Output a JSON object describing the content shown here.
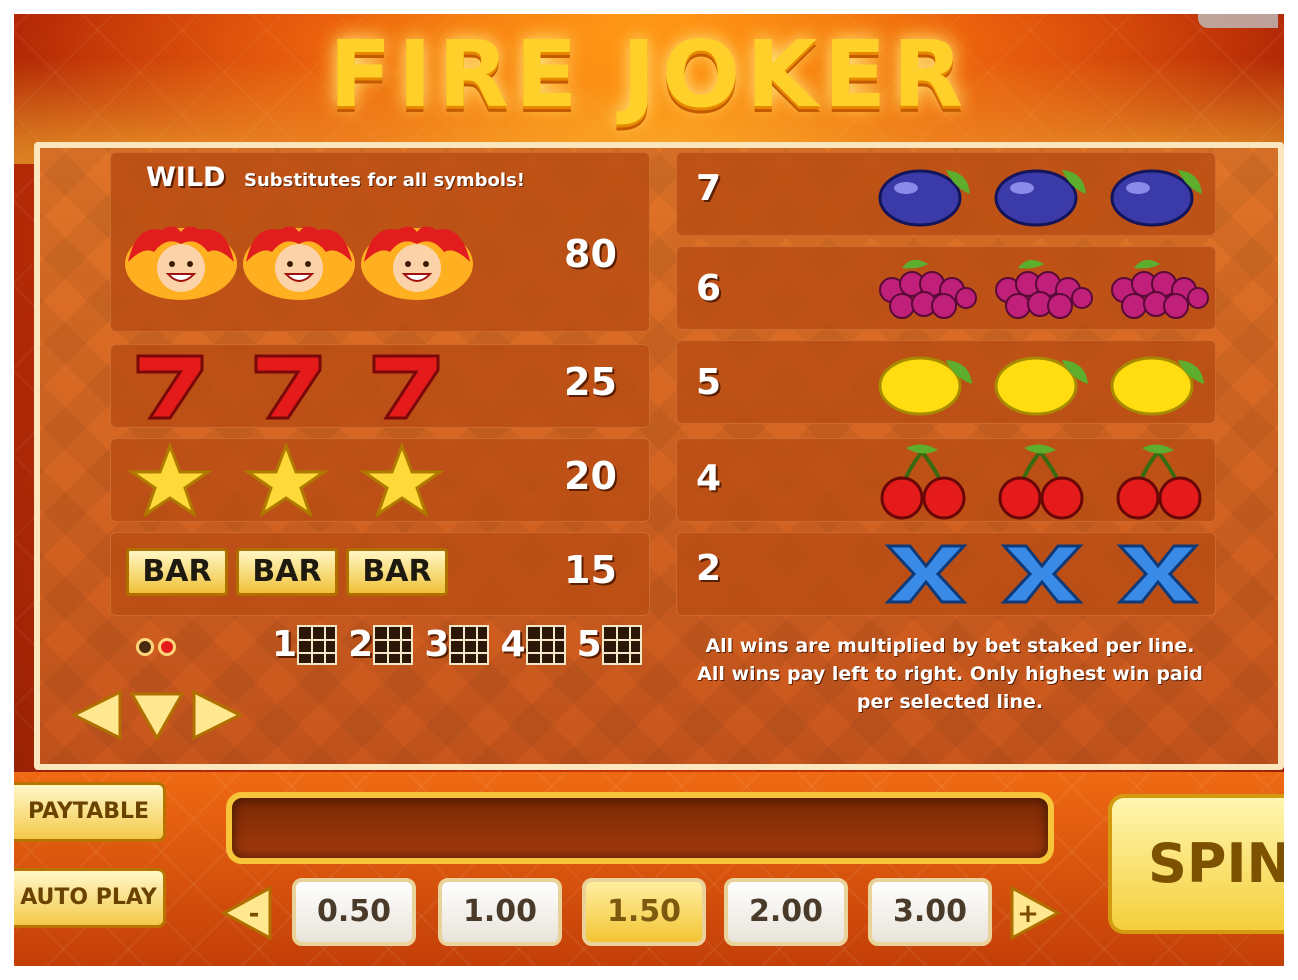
{
  "title": "FIRE JOKER",
  "wild": {
    "label": "WILD",
    "description": "Substitutes for all symbols!",
    "payout": "80"
  },
  "left_rows": [
    {
      "symbol": "seven",
      "payout": "25"
    },
    {
      "symbol": "star",
      "payout": "20"
    },
    {
      "symbol": "bar",
      "label": "BAR",
      "payout": "15"
    }
  ],
  "right_rows": [
    {
      "symbol": "plum",
      "payout": "7"
    },
    {
      "symbol": "grapes",
      "payout": "6"
    },
    {
      "symbol": "lemon",
      "payout": "5"
    },
    {
      "symbol": "cherry",
      "payout": "4"
    },
    {
      "symbol": "x",
      "payout": "2"
    }
  ],
  "paylines": [
    "1",
    "2",
    "3",
    "4",
    "5"
  ],
  "rules_text": [
    "All wins are multiplied by bet staked per line.",
    "All wins pay left to right. Only highest win paid",
    "per selected line."
  ],
  "controls": {
    "paytable": "PAYTABLE",
    "autoplay": "AUTO PLAY",
    "spin": "SPIN",
    "minus": "-",
    "plus": "+",
    "bets": [
      "0.50",
      "1.00",
      "1.50",
      "2.00",
      "3.00"
    ],
    "active_bet": "1.50"
  },
  "colors": {
    "accent": "#f5cf3a",
    "panel": "#c9561d"
  }
}
